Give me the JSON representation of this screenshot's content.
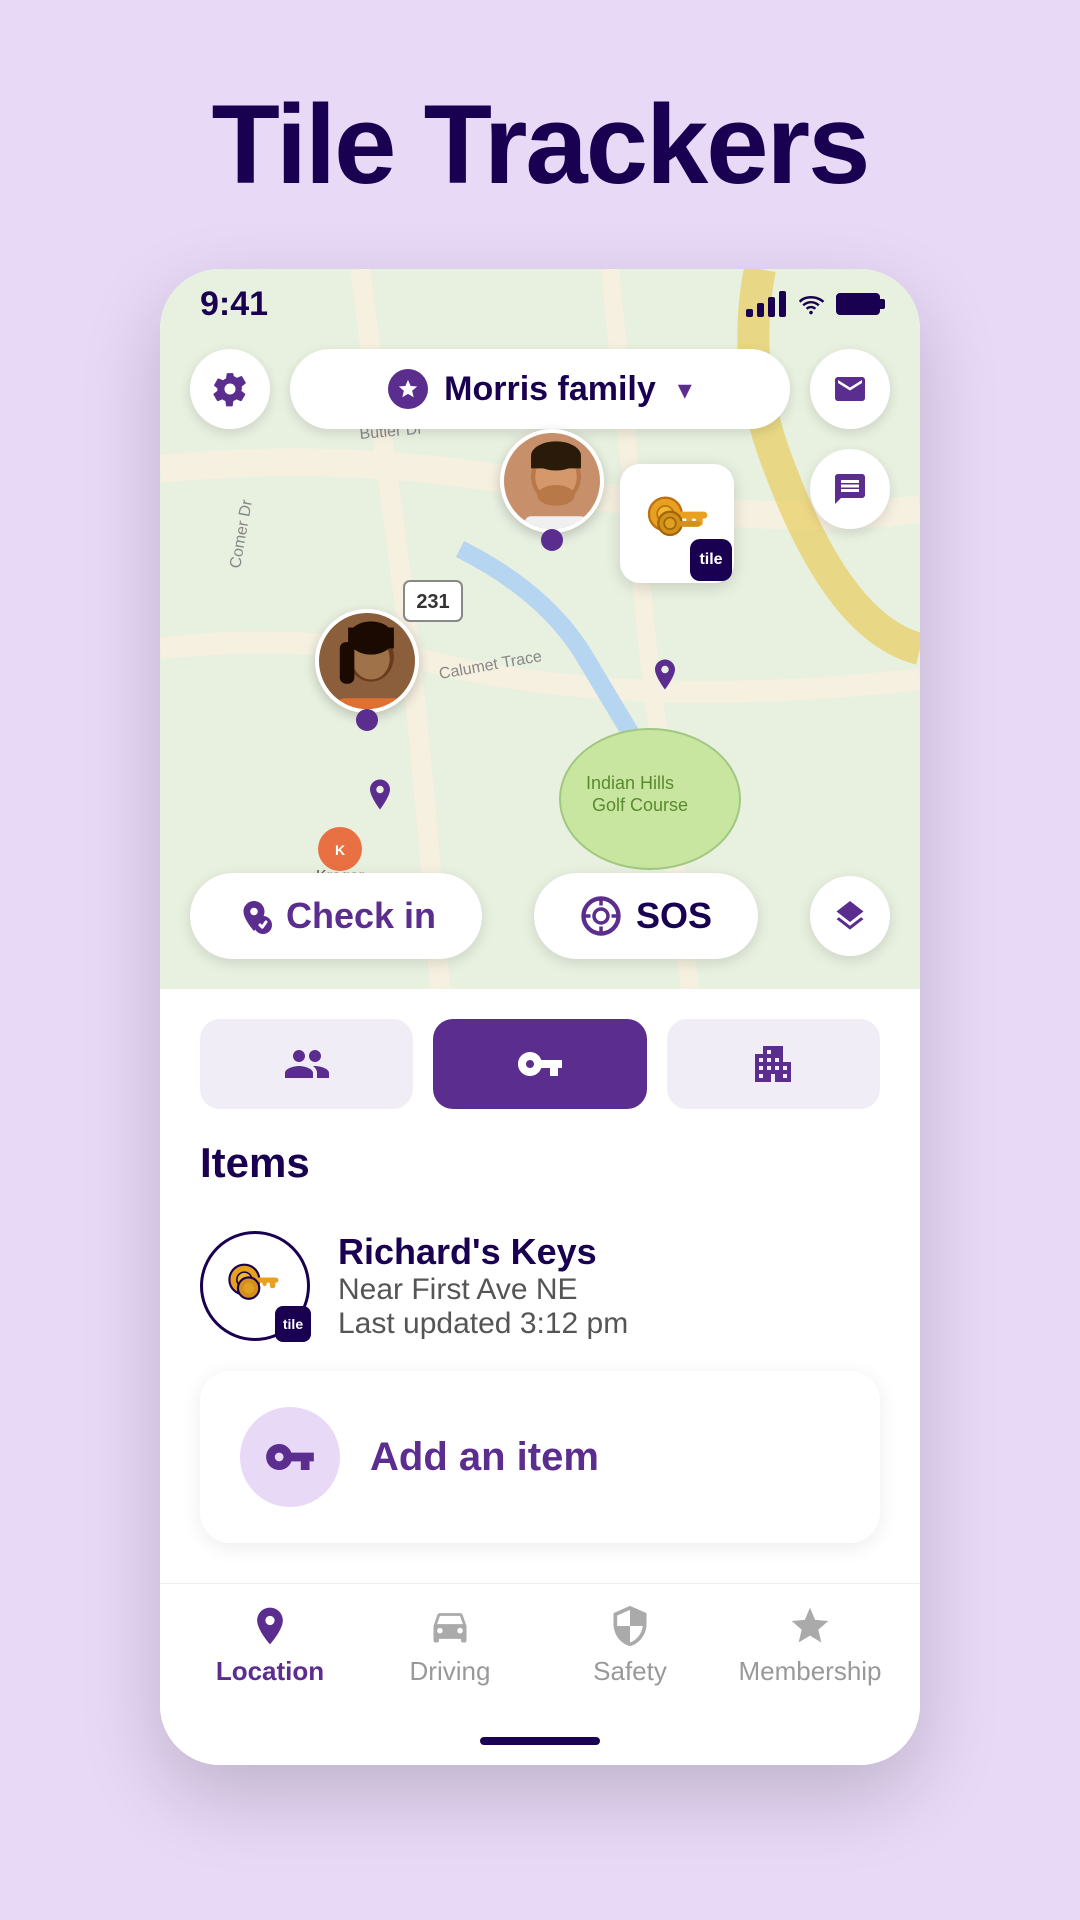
{
  "page": {
    "title": "Tile Trackers",
    "background_color": "#e8d9f7"
  },
  "status_bar": {
    "time": "9:41"
  },
  "header": {
    "family_name": "Morris family",
    "dropdown_label": "▾"
  },
  "map": {
    "check_in_label": "Check in",
    "sos_label": "SOS"
  },
  "tabs": [
    {
      "icon": "people",
      "active": false
    },
    {
      "icon": "key",
      "active": true
    },
    {
      "icon": "building",
      "active": false
    }
  ],
  "items_section": {
    "label": "Items",
    "items": [
      {
        "name": "Richard's Keys",
        "location": "Near First Ave NE",
        "updated": "Last updated 3:12 pm"
      }
    ]
  },
  "add_item": {
    "label": "Add an item"
  },
  "bottom_nav": [
    {
      "label": "Location",
      "active": true
    },
    {
      "label": "Driving",
      "active": false
    },
    {
      "label": "Safety",
      "active": false
    },
    {
      "label": "Membership",
      "active": false
    }
  ]
}
